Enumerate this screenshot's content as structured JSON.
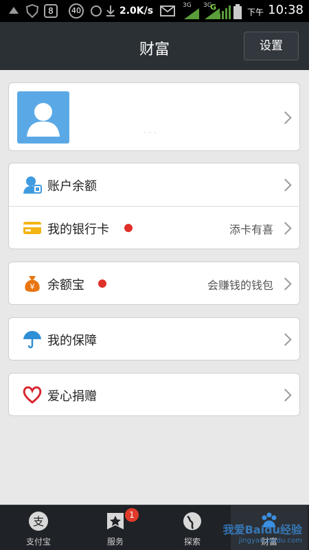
{
  "status_bar": {
    "speed": "2.0K/s",
    "network_3g_a": "3G",
    "network_3g_b": "3G",
    "network_g": "G",
    "ampm": "下午",
    "time": "10:38",
    "notif_8": "8",
    "notif_40": "40"
  },
  "header": {
    "title": "财富",
    "settings_label": "设置"
  },
  "account": {
    "name": ". . ."
  },
  "rows": {
    "balance": "账户余额",
    "bank_card": "我的银行卡",
    "bank_card_sub": "添卡有喜",
    "yuebao": "余额宝",
    "yuebao_sub": "会赚钱的钱包",
    "insurance": "我的保障",
    "charity": "爱心捐赠"
  },
  "tabbar": {
    "tabs": [
      {
        "label": "支付宝",
        "icon": "alipay-icon"
      },
      {
        "label": "服务",
        "icon": "star-icon",
        "badge": "1"
      },
      {
        "label": "探索",
        "icon": "globe-icon"
      },
      {
        "label": "财富",
        "icon": "paw-icon"
      }
    ],
    "watermark": "我爱Baidu经验",
    "watermark_sub": "jingyan.baidu.com"
  },
  "colors": {
    "header_bg": "#2b3035",
    "red_dot": "#e0302a",
    "avatar": "#5aa9e6"
  }
}
